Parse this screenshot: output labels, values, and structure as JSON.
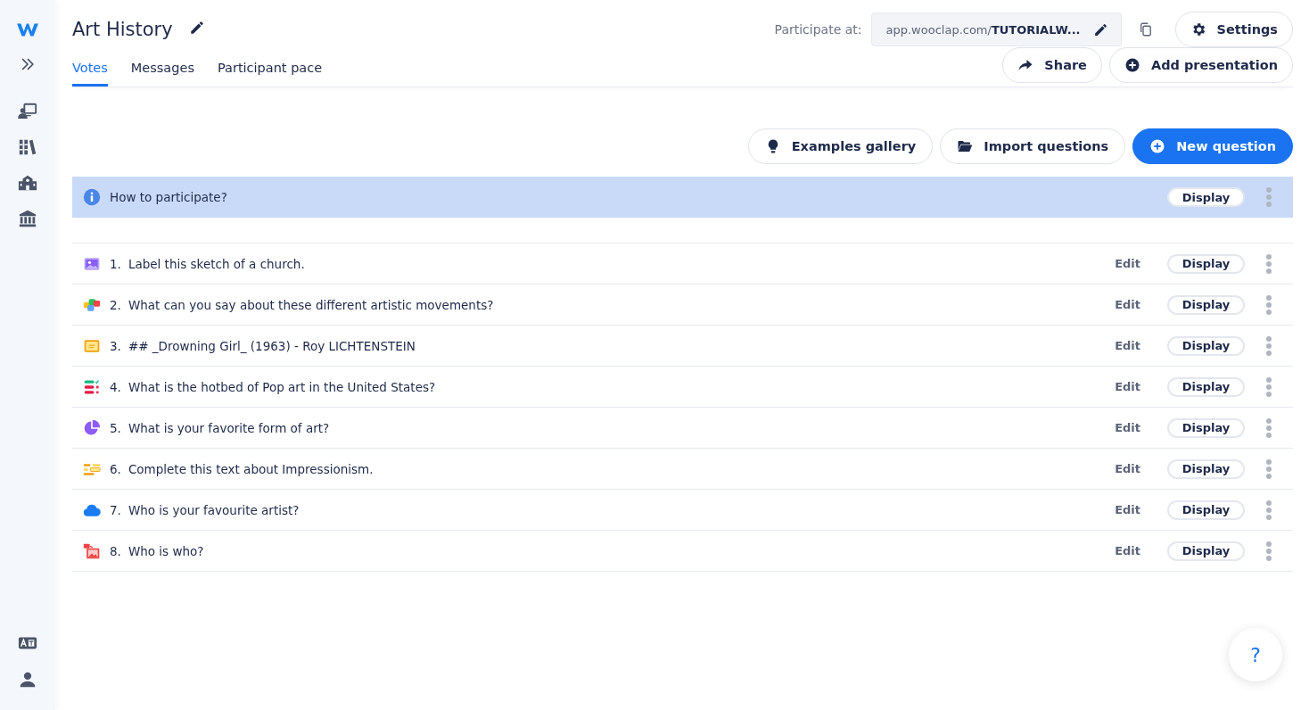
{
  "header": {
    "title": "Art History",
    "participate_label": "Participate at:",
    "url_prefix": "app.wooclap.com/",
    "url_code": "TUTORIALW...",
    "buttons": [
      {
        "kind": "settings",
        "label": "Settings"
      },
      {
        "kind": "share",
        "label": "Share"
      },
      {
        "kind": "add",
        "label": "Add presentation"
      }
    ]
  },
  "tabs": [
    {
      "label": "Votes",
      "selected": true
    },
    {
      "label": "Messages",
      "selected": false
    },
    {
      "label": "Participant pace",
      "selected": false
    }
  ],
  "actions": [
    {
      "kind": "gallery",
      "label": "Examples gallery",
      "primary": false
    },
    {
      "kind": "import",
      "label": "Import questions",
      "primary": false
    },
    {
      "kind": "new",
      "label": "New question",
      "primary": true
    }
  ],
  "intro": {
    "label": "How to participate?",
    "display": "Display",
    "selected": true
  },
  "questions": [
    {
      "kind": "label",
      "number": "1.",
      "text": "Label this sketch of a church.",
      "edit": "Edit",
      "display": "Display"
    },
    {
      "kind": "mixed",
      "number": "2.",
      "text": "What can you say about these different artistic movements?",
      "edit": "Edit",
      "display": "Display"
    },
    {
      "kind": "slide",
      "number": "3.",
      "text": "## _Drowning Girl_ (1963) - Roy LICHTENSTEIN",
      "edit": "Edit",
      "display": "Display"
    },
    {
      "kind": "mcq",
      "number": "4.",
      "text": "What is the hotbed of Pop art in the United States?",
      "edit": "Edit",
      "display": "Display"
    },
    {
      "kind": "poll",
      "number": "5.",
      "text": "What is your favorite form of art?",
      "edit": "Edit",
      "display": "Display"
    },
    {
      "kind": "fill",
      "number": "6.",
      "text": "Complete this text about Impressionism.",
      "edit": "Edit",
      "display": "Display"
    },
    {
      "kind": "cloud",
      "number": "7.",
      "text": "Who is your favourite artist?",
      "edit": "Edit",
      "display": "Display"
    },
    {
      "kind": "matching",
      "number": "8.",
      "text": "Who is who?",
      "edit": "Edit",
      "display": "Display"
    }
  ],
  "help": "?"
}
